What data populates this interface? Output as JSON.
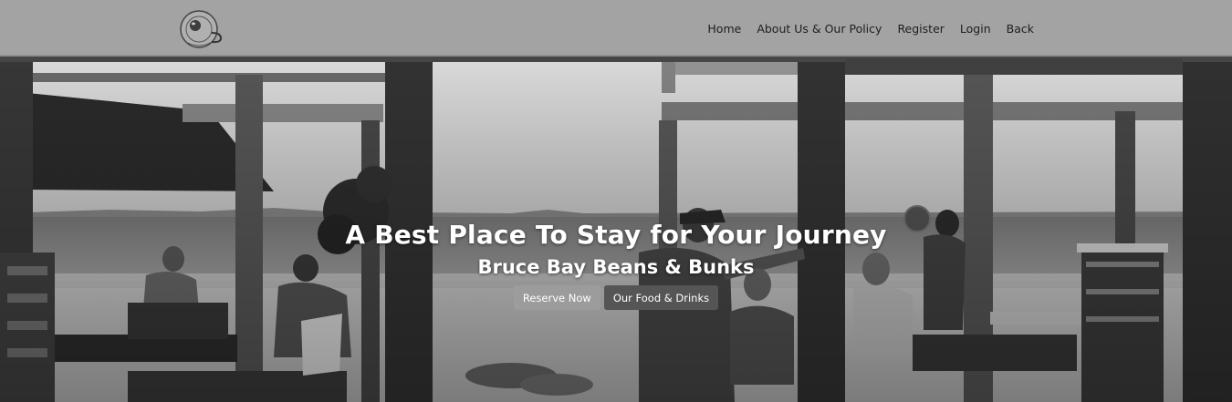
{
  "nav": {
    "items": [
      {
        "label": "Home"
      },
      {
        "label": "About Us & Our Policy"
      },
      {
        "label": "Register"
      },
      {
        "label": "Login"
      },
      {
        "label": "Back"
      }
    ]
  },
  "hero": {
    "title": "A Best Place To Stay for Your Journey",
    "subtitle": "Bruce Bay Beans & Bunks",
    "buttons": {
      "reserve": "Reserve Now",
      "food": "Our Food & Drinks"
    }
  },
  "colors": {
    "navbar_bg": "#a3a3a3",
    "reserve_btn": "#9c9c9c",
    "food_btn": "#555555"
  }
}
